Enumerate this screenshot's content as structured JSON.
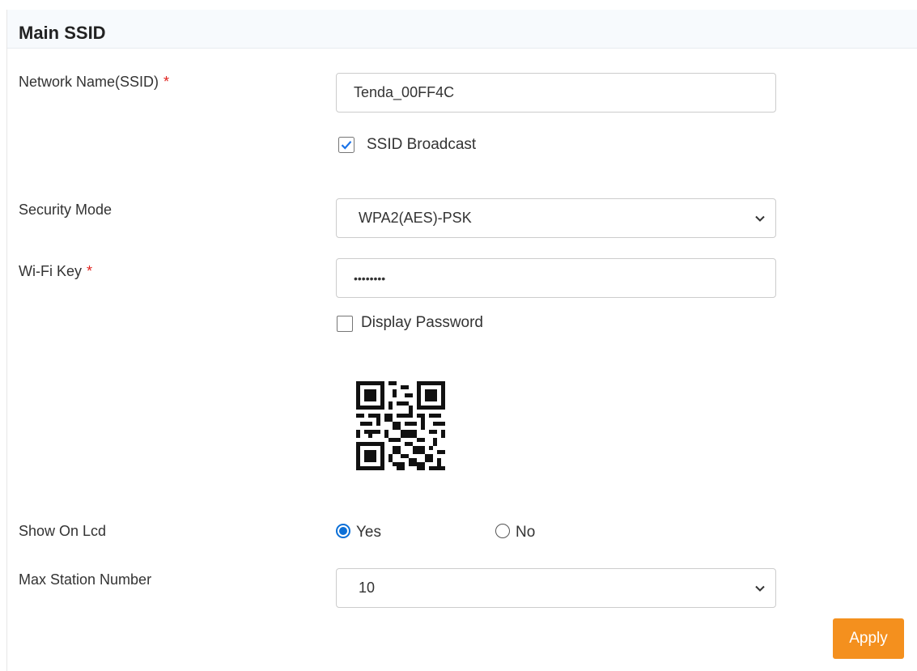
{
  "section": {
    "title": "Main SSID"
  },
  "ssid": {
    "label": "Network Name(SSID)",
    "required_mark": "*",
    "value": "Tenda_00FF4C",
    "broadcast_label": "SSID Broadcast",
    "broadcast_checked": true
  },
  "security": {
    "label": "Security Mode",
    "selected": "WPA2(AES)-PSK"
  },
  "wifi_key": {
    "label": "Wi-Fi Key",
    "required_mark": "*",
    "masked_value": "••••••••",
    "display_password_label": "Display Password",
    "display_password_checked": false
  },
  "qr": {
    "icon": "qr-code-icon"
  },
  "lcd": {
    "label": "Show On Lcd",
    "options": [
      "Yes",
      "No"
    ],
    "selected": "Yes"
  },
  "max_station": {
    "label": "Max Station Number",
    "selected": "10"
  },
  "apply_label": "Apply",
  "colors": {
    "accent_orange": "#f4901e",
    "radio_blue": "#0b6fd7",
    "checkbox_blue": "#1a73e8",
    "required_red": "#e0211d"
  }
}
